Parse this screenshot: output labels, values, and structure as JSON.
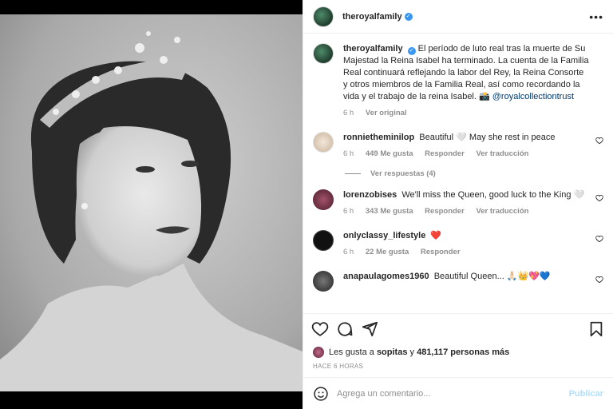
{
  "post": {
    "username": "theroyalfamily",
    "verified_icon": "verified-badge-icon",
    "caption": "El período de luto real tras la muerte de Su Majestad la Reina Isabel ha terminado. La cuenta de la Familia Real continuará reflejando la labor del Rey, la Reina Consorte y otros miembros de la Familia Real, así como recordando la vida y el trabajo de la reina Isabel. 📸",
    "caption_mention": "@royalcollectiontrust",
    "caption_time": "6 h",
    "see_original": "Ver original"
  },
  "comments": [
    {
      "user": "ronnietheminilop",
      "text": "Beautiful 🤍 May she rest in peace",
      "time": "6 h",
      "likes": "449 Me gusta",
      "reply": "Responder",
      "translate": "Ver traducción"
    },
    {
      "user": "lorenzobises",
      "text": "We'll miss the Queen, good luck to the King 🤍",
      "time": "6 h",
      "likes": "343 Me gusta",
      "reply": "Responder",
      "translate": "Ver traducción"
    },
    {
      "user": "onlyclassy_lifestyle",
      "text": "❤️",
      "time": "6 h",
      "likes": "22 Me gusta",
      "reply": "Responder"
    },
    {
      "user": "anapaulagomes1960",
      "text": "Beautiful Queen... 🙏🏻👑💖💙"
    }
  ],
  "view_replies": "Ver respuestas (4)",
  "likes_line": {
    "prefix": "Les gusta a",
    "user": "sopitas",
    "middle": "y",
    "count": "481,117 personas más"
  },
  "time_ago": "HACE 6 HORAS",
  "comment_box": {
    "placeholder": "Agrega un comentario...",
    "publish": "Publicar"
  },
  "colors": {
    "accent": "#3897f0",
    "link": "#00376b",
    "publish_disabled": "#b2dffc"
  }
}
